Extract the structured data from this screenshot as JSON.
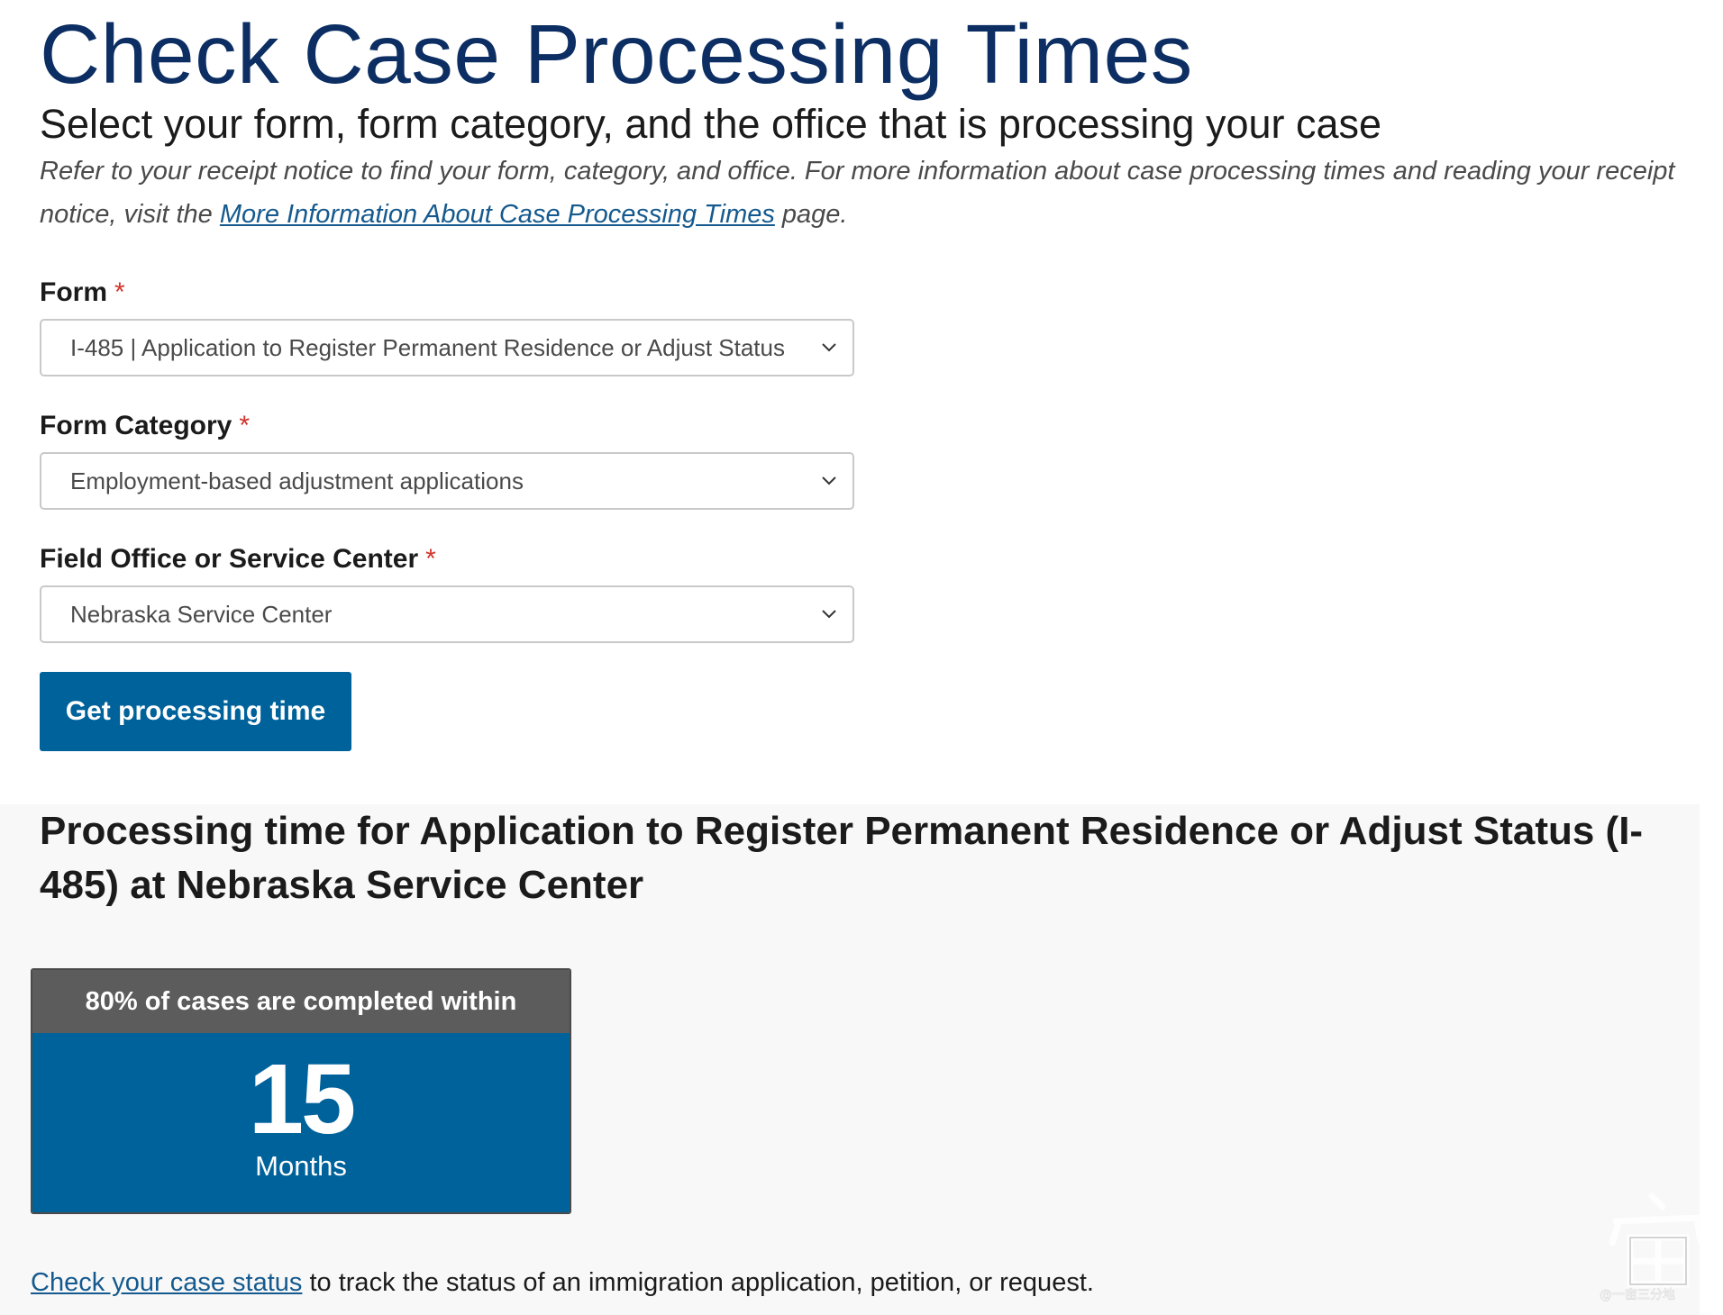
{
  "header": {
    "title": "Check Case Processing Times",
    "subtitle": "Select your form, form category, and the office that is processing your case",
    "intro_before": "Refer to your receipt notice to find your form, category, and office. For more information about case processing times and reading your receipt notice, visit the ",
    "intro_link": "More Information About Case Processing Times",
    "intro_after": " page."
  },
  "form": {
    "form_field": {
      "label": "Form",
      "required_mark": "*",
      "value": "I-485 | Application to Register Permanent Residence or Adjust Status"
    },
    "category_field": {
      "label": "Form Category",
      "required_mark": "*",
      "value": "Employment-based adjustment applications"
    },
    "office_field": {
      "label": "Field Office or Service Center",
      "required_mark": "*",
      "value": "Nebraska Service Center"
    },
    "submit_label": "Get processing time"
  },
  "result": {
    "title": "Processing time for Application to Register Permanent Residence or Adjust Status (I-485) at Nebraska Service Center",
    "card_header": "80% of cases are completed within",
    "value": "15",
    "unit": "Months",
    "footer_link": "Check your case status",
    "footer_text": " to track the status of an immigration application, petition, or request."
  },
  "colors": {
    "title": "#0c2e63",
    "link": "#155a8e",
    "primary_button": "#00629b",
    "card_header": "#5c5c5c",
    "required": "#d2352c"
  },
  "icons": {
    "select_chevron": "chevron-down-icon",
    "watermark": "watermark-logo"
  },
  "watermark": {
    "text": "@一亩三分地"
  }
}
